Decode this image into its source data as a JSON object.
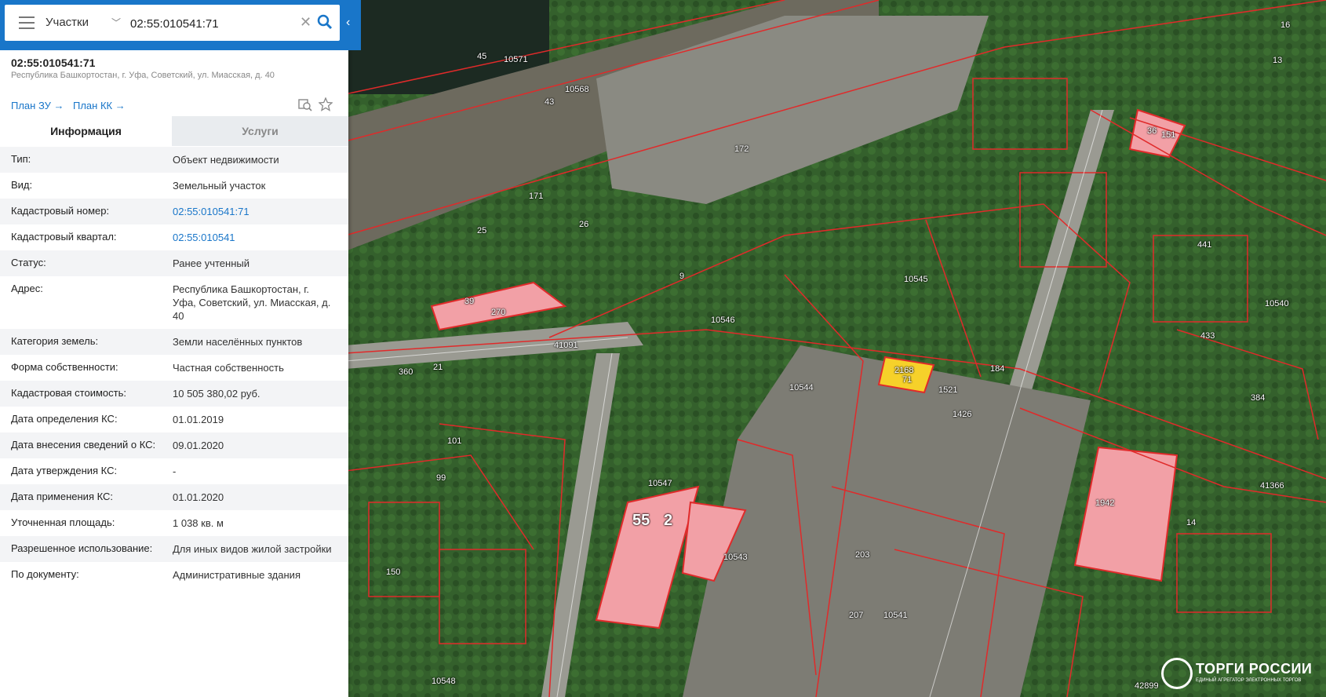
{
  "search": {
    "layer": "Участки",
    "query": "02:55:010541:71"
  },
  "object": {
    "title": "02:55:010541:71",
    "address": "Республика Башкортостан, г. Уфа, Советский, ул. Миасская, д. 40",
    "plan_zu": "План ЗУ →",
    "plan_kk": "План КК →"
  },
  "tabs": {
    "info": "Информация",
    "services": "Услуги"
  },
  "info_rows": [
    {
      "key": "Тип:",
      "value": "Объект недвижимости",
      "link": false
    },
    {
      "key": "Вид:",
      "value": "Земельный участок",
      "link": false
    },
    {
      "key": "Кадастровый номер:",
      "value": "02:55:010541:71",
      "link": true
    },
    {
      "key": "Кадастровый квартал:",
      "value": "02:55:010541",
      "link": true
    },
    {
      "key": "Статус:",
      "value": "Ранее учтенный",
      "link": false
    },
    {
      "key": "Адрес:",
      "value": "Республика Башкортостан, г. Уфа, Советский, ул. Миасская, д. 40",
      "link": false
    },
    {
      "key": "Категория земель:",
      "value": "Земли населённых пунктов",
      "link": false
    },
    {
      "key": "Форма собственности:",
      "value": "Частная собственность",
      "link": false
    },
    {
      "key": "Кадастровая стоимость:",
      "value": "10 505 380,02 руб.",
      "link": false
    },
    {
      "key": "Дата определения КС:",
      "value": "01.01.2019",
      "link": false
    },
    {
      "key": "Дата внесения сведений о КС:",
      "value": "09.01.2020",
      "link": false
    },
    {
      "key": "Дата утверждения КС:",
      "value": "-",
      "link": false
    },
    {
      "key": "Дата применения КС:",
      "value": "01.01.2020",
      "link": false
    },
    {
      "key": "Уточненная площадь:",
      "value": "1 038 кв. м",
      "link": false
    },
    {
      "key": "Разрешенное использование:",
      "value": "Для иных видов жилой застройки",
      "link": false
    },
    {
      "key": "По документу:",
      "value": "Административные здания",
      "link": false
    }
  ],
  "map": {
    "labels": [
      {
        "t": "45"
      },
      {
        "t": "10571"
      },
      {
        "t": "10568"
      },
      {
        "t": "43"
      },
      {
        "t": "172"
      },
      {
        "t": "171"
      },
      {
        "t": "26"
      },
      {
        "t": "25"
      },
      {
        "t": "9"
      },
      {
        "t": "39"
      },
      {
        "t": "270"
      },
      {
        "t": "41091"
      },
      {
        "t": "360"
      },
      {
        "t": "21"
      },
      {
        "t": "10546"
      },
      {
        "t": "10545"
      },
      {
        "t": "10544"
      },
      {
        "t": "10547"
      },
      {
        "t": "55"
      },
      {
        "t": "2"
      },
      {
        "t": "10543"
      },
      {
        "t": "10541"
      },
      {
        "t": "10540"
      },
      {
        "t": "41366"
      },
      {
        "t": "1942"
      },
      {
        "t": "184"
      },
      {
        "t": "1426"
      },
      {
        "t": "1521"
      },
      {
        "t": "2168"
      },
      {
        "t": "71"
      },
      {
        "t": "203"
      },
      {
        "t": "207"
      },
      {
        "t": "14"
      },
      {
        "t": "10548"
      },
      {
        "t": "101"
      },
      {
        "t": "99"
      },
      {
        "t": "150"
      },
      {
        "t": "16"
      },
      {
        "t": "13"
      },
      {
        "t": "36"
      },
      {
        "t": "151"
      },
      {
        "t": "441"
      },
      {
        "t": "433"
      },
      {
        "t": "384"
      },
      {
        "t": "42899"
      }
    ],
    "colors": {
      "boundary": "#e02a2a",
      "parcel_fill": "#f2a0a6",
      "selected": "#f6d12a",
      "tree": "#2f5a2a",
      "ground": "#7a7a66"
    }
  },
  "branding": {
    "name": "ТОРГИ РОССИИ",
    "subtitle": "ЕДИНЫЙ АГРЕГАТОР ЭЛЕКТРОННЫХ ТОРГОВ"
  }
}
